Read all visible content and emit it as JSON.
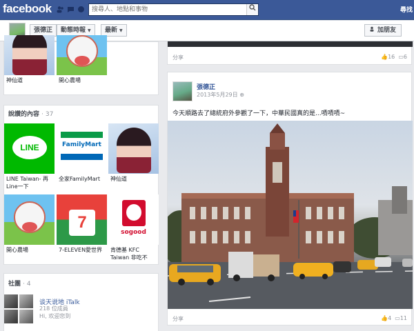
{
  "topbar": {
    "logo": "facebook",
    "search_placeholder": "搜尋人、地點和事物",
    "home_link": "尋找"
  },
  "profilebar": {
    "name": "張德正",
    "timeline_btn": "動態時報",
    "recent_btn": "最新",
    "add_friend": "加朋友"
  },
  "left": {
    "apps_top": [
      {
        "label": "神仙道",
        "icon": "game-girl-icon"
      },
      {
        "label": "開心農場",
        "icon": "farm-cow-icon"
      }
    ],
    "likes": {
      "title": "說讚的內容",
      "count": "· 37",
      "items": [
        {
          "label": "LINE Taiwan- 再Line一下",
          "icon": "line-icon"
        },
        {
          "label": "全家FamilyMart",
          "icon": "familymart-icon"
        },
        {
          "label": "神仙道",
          "icon": "game-girl-icon"
        },
        {
          "label": "開心農場",
          "icon": "farm-cow-icon"
        },
        {
          "label": "7-ELEVEN愛世界",
          "icon": "seven-eleven-icon"
        },
        {
          "label": "肯德基 KFC Taiwan 非吃不",
          "icon": "kfc-icon"
        }
      ]
    },
    "groups": {
      "title": "社團",
      "count": "· 4",
      "items": [
        {
          "name": "谈天说地 iTalk",
          "members": "218 位成員",
          "preview": "Hi, 欢迎您到"
        }
      ]
    }
  },
  "posts": [
    {
      "share": "分享",
      "likes": "16",
      "comments": "6"
    },
    {
      "author": "張德正",
      "date": "2013年5月29日",
      "text": "今天順路去了總統府外參觀了一下，中華民國真的是...嘖嘖嘖~",
      "share": "分享",
      "likes": "4",
      "comments": "11"
    }
  ],
  "colors": {
    "brand_blue": "#3b5998",
    "link_blue": "#365899",
    "page_bg": "#e9eaed"
  }
}
